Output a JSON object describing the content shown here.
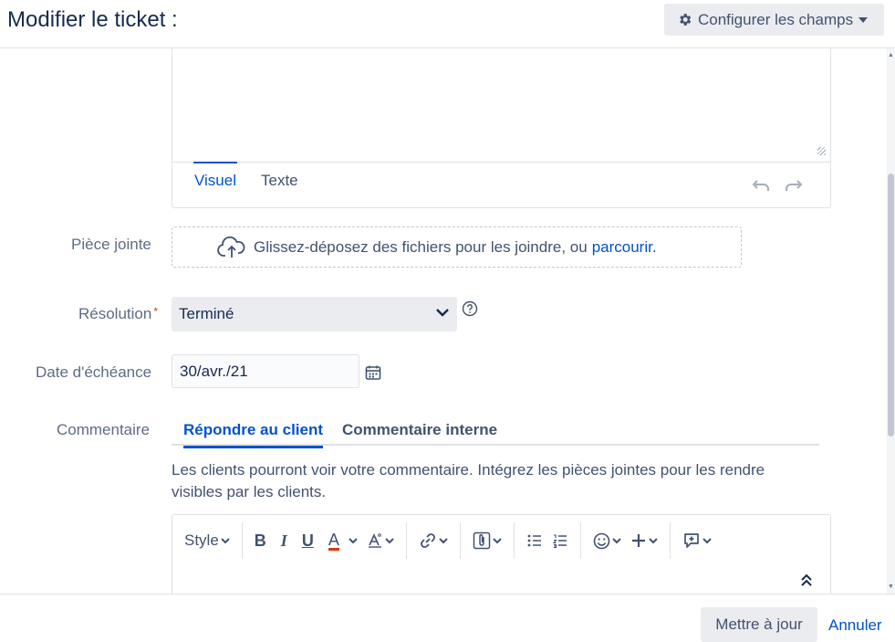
{
  "header": {
    "title": "Modifier le ticket :",
    "config_button": "Configurer les champs"
  },
  "description_editor": {
    "tabs": [
      {
        "label": "Visuel",
        "active": true
      },
      {
        "label": "Texte",
        "active": false
      }
    ]
  },
  "fields": {
    "attachment": {
      "label": "Pièce jointe",
      "drop_text": "Glissez-déposez des fichiers pour les joindre, ou",
      "browse_link": "parcourir."
    },
    "resolution": {
      "label": "Résolution",
      "required_marker": "*",
      "value": "Terminé"
    },
    "due_date": {
      "label": "Date d'échéance",
      "value": "30/avr./21"
    },
    "comment": {
      "label": "Commentaire",
      "tabs": [
        {
          "label": "Répondre au client",
          "active": true
        },
        {
          "label": "Commentaire interne",
          "active": false
        }
      ],
      "info": "Les clients pourront voir votre commentaire. Intégrez les pièces jointes pour les rendre visibles par les clients.",
      "toolbar": {
        "style_label": "Style",
        "bold": "B",
        "italic": "I",
        "underline": "U",
        "text_color": "A"
      }
    }
  },
  "footer": {
    "update_button": "Mettre à jour",
    "cancel_link": "Annuler"
  },
  "colors": {
    "accent": "#0052cc",
    "required": "#de350b",
    "text_color_underline": "#de350b",
    "button_bg": "#ebecf0",
    "border": "#dfe1e6"
  }
}
